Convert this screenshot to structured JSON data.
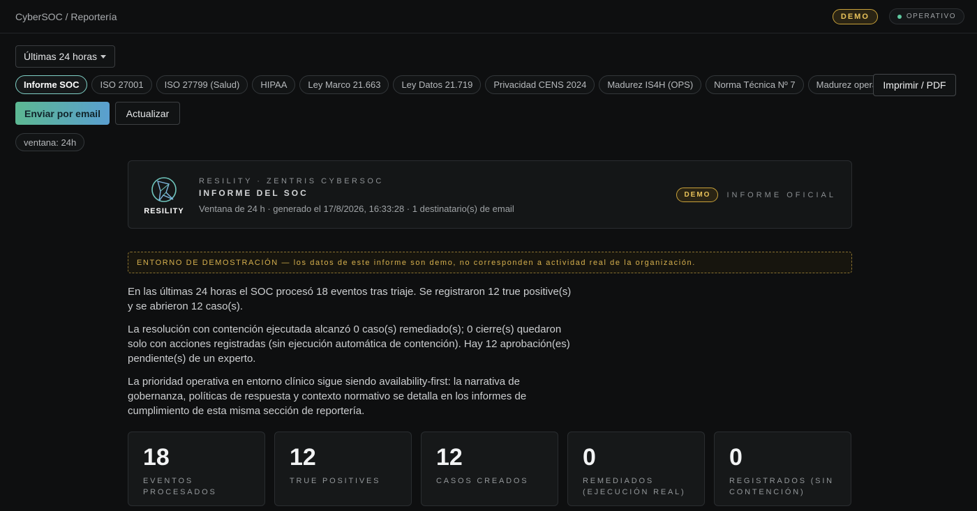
{
  "header": {
    "breadcrumb": "CyberSOC / Reportería",
    "demo_badge": "DEMO",
    "status_label": "OPERATIVO",
    "status_color": "#5fc9a0"
  },
  "controls": {
    "range_select": "Últimas 24 horas",
    "report_tabs": [
      {
        "label": "Informe SOC",
        "active": true
      },
      {
        "label": "ISO 27001"
      },
      {
        "label": "ISO 27799 (Salud)"
      },
      {
        "label": "HIPAA"
      },
      {
        "label": "Ley Marco 21.663"
      },
      {
        "label": "Ley Datos 21.719"
      },
      {
        "label": "Privacidad CENS 2024"
      },
      {
        "label": "Madurez IS4H (OPS)"
      },
      {
        "label": "Norma Técnica Nº 7"
      },
      {
        "label": "Madurez operativa"
      }
    ],
    "print_label": "Imprimir / PDF",
    "email_label": "Enviar por email",
    "refresh_label": "Actualizar",
    "window_chip": "ventana: 24h"
  },
  "report": {
    "logo_text": "RESILITY",
    "org_line": "Resility · Zentris CyberSOC",
    "title": "Informe del SOC",
    "subtitle": "Ventana de 24 h · generado el 17/8/2026, 16:33:28 · 1 destinatario(s) de email",
    "demo_badge": "DEMO",
    "official_label": "Informe oficial"
  },
  "demo_banner": "ENTORNO DE DEMOSTRACIÓN — los datos de este informe son demo, no corresponden a actividad real de la organización.",
  "summary": {
    "p1": "En las últimas 24 horas el SOC procesó 18 eventos tras triaje. Se registraron 12 true positive(s) y se abrieron 12 caso(s).",
    "p2": "La resolución con contención ejecutada alcanzó 0 caso(s) remediado(s); 0 cierre(s) quedaron solo con acciones registradas (sin ejecución automática de contención). Hay 12 aprobación(es) pendiente(s) de un experto.",
    "p3": "La prioridad operativa en entorno clínico sigue siendo availability-first: la narrativa de gobernanza, políticas de respuesta y contexto normativo se detalla en los informes de cumplimiento de esta misma sección de reportería."
  },
  "kpis": [
    {
      "value": "18",
      "label": "Eventos procesados"
    },
    {
      "value": "12",
      "label": "True positives"
    },
    {
      "value": "12",
      "label": "Casos creados"
    },
    {
      "value": "0",
      "label": "Remediados (ejecución real)"
    },
    {
      "value": "0",
      "label": "Registrados (sin contención)"
    }
  ]
}
